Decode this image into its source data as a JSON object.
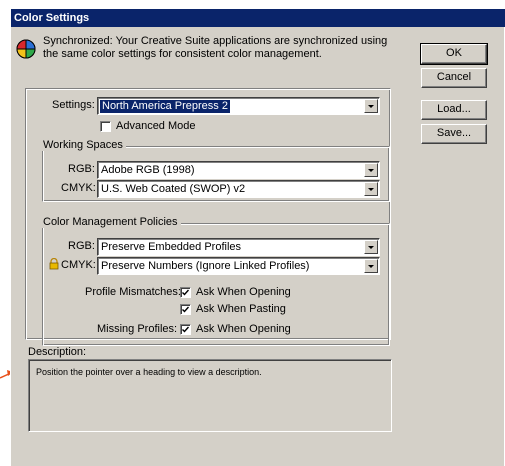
{
  "window": {
    "title": "Color Settings"
  },
  "sync": {
    "message": "Synchronized: Your Creative Suite applications are synchronized using the same color settings for consistent color management."
  },
  "buttons": {
    "ok": "OK",
    "cancel": "Cancel",
    "load": "Load...",
    "save": "Save..."
  },
  "settings": {
    "label": "Settings:",
    "value": "North America Prepress 2",
    "advanced_mode_label": "Advanced Mode",
    "advanced_mode_checked": false
  },
  "working_spaces": {
    "title": "Working Spaces",
    "rgb_label": "RGB:",
    "rgb_value": "Adobe RGB (1998)",
    "cmyk_label": "CMYK:",
    "cmyk_value": "U.S. Web Coated (SWOP) v2"
  },
  "policies": {
    "title": "Color Management Policies",
    "rgb_label": "RGB:",
    "rgb_value": "Preserve Embedded Profiles",
    "cmyk_label": "CMYK:",
    "cmyk_value": "Preserve Numbers (Ignore Linked Profiles)",
    "profile_mismatches_label": "Profile Mismatches:",
    "ask_when_opening_label": "Ask When Opening",
    "ask_when_pasting_label": "Ask When Pasting",
    "missing_profiles_label": "Missing Profiles:",
    "missing_ask_when_opening_label": "Ask When Opening"
  },
  "description": {
    "label": "Description:",
    "text": "Position the pointer over a heading to view a description."
  },
  "colors": {
    "titlebar": "#0a246a",
    "dialog": "#d4d0c8",
    "pointer": "#e8501a"
  }
}
